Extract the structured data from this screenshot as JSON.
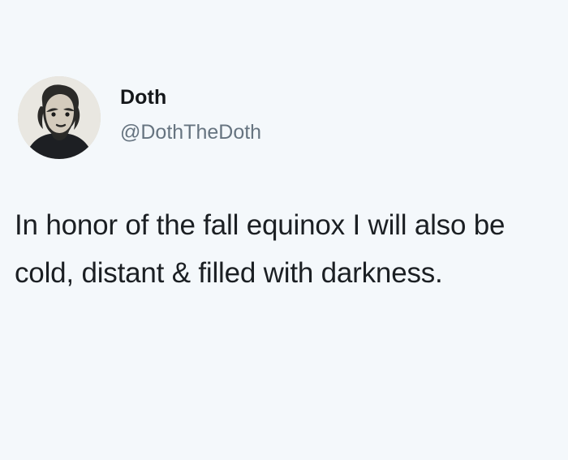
{
  "tweet": {
    "author": {
      "display_name": "Doth",
      "handle": "@DothTheDoth",
      "avatar_icon": "profile-avatar"
    },
    "body": "In honor of the fall equinox I will also be cold, distant & filled with darkness."
  },
  "colors": {
    "background": "#f4f8fb",
    "text_primary": "#14171a",
    "text_secondary": "#667480"
  }
}
